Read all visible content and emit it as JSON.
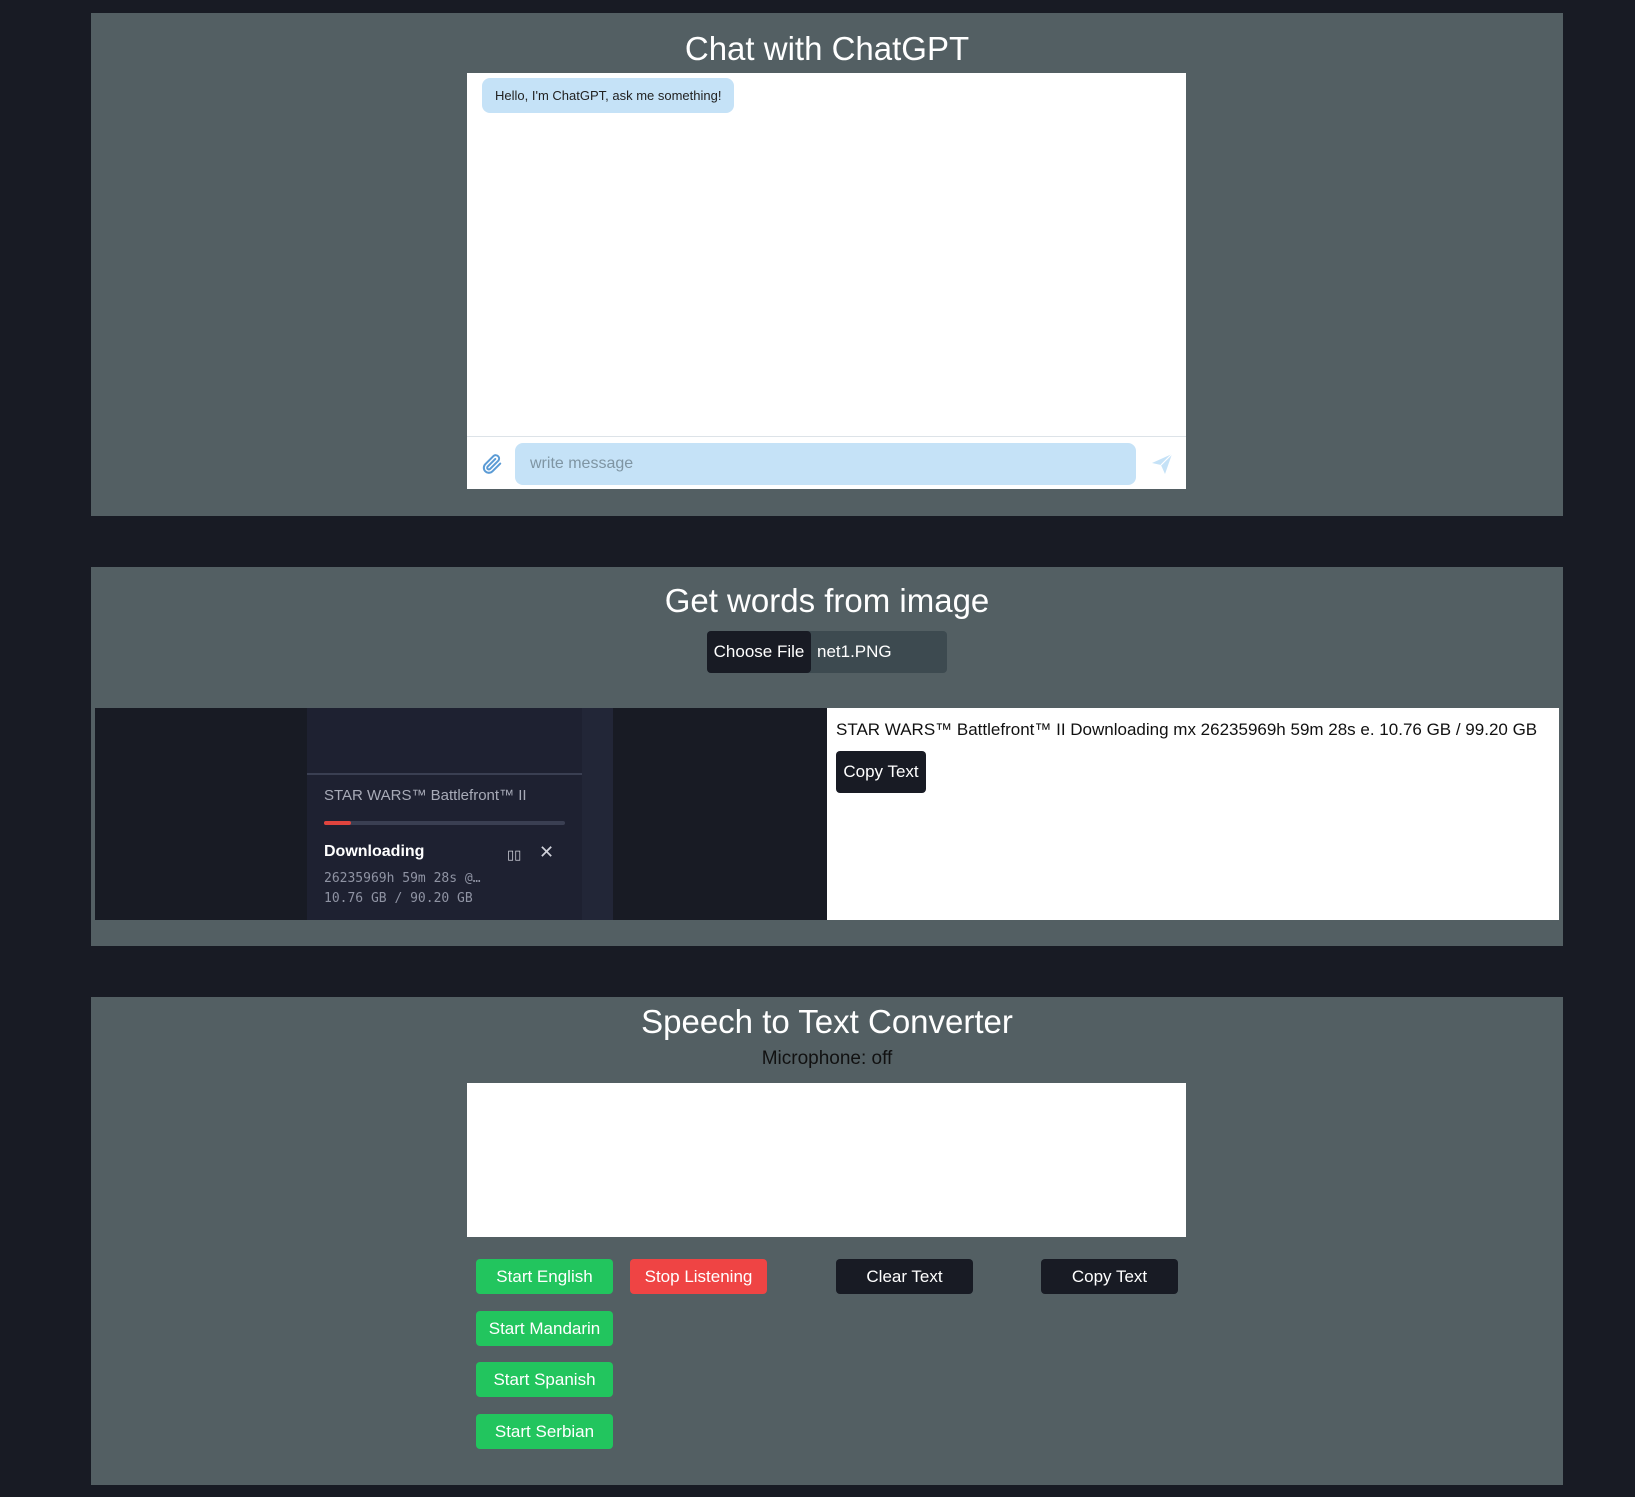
{
  "chat": {
    "title": "Chat with ChatGPT",
    "greeting": "Hello, I'm ChatGPT, ask me something!",
    "input_placeholder": "write message",
    "input_value": "",
    "attach_icon": "paperclip-icon",
    "send_icon": "send-icon"
  },
  "image_ocr": {
    "title": "Get words from image",
    "choose_file_label": "Choose File",
    "file_name": "net1.PNG",
    "preview": {
      "game_title": "STAR WARS™ Battlefront™ II",
      "progress": 0.11,
      "progress_color": "#e0443e",
      "status": "Downloading",
      "pause_icon": "pause-icon",
      "close_icon": "close-icon",
      "time_remaining": "26235969h 59m 28s @…",
      "size": "10.76 GB / 90.20 GB"
    },
    "extracted_text": "STAR WARS™ Battlefront™ II Downloading mx 26235969h 59m 28s e. 10.76 GB / 99.20 GB",
    "copy_label": "Copy Text"
  },
  "speech": {
    "title": "Speech to Text Converter",
    "mic_status": "Microphone: off",
    "transcript": "",
    "buttons": {
      "start_english": "Start English",
      "stop_listening": "Stop Listening",
      "clear_text": "Clear Text",
      "copy_text": "Copy Text",
      "start_mandarin": "Start Mandarin",
      "start_spanish": "Start Spanish",
      "start_serbian": "Start Serbian"
    }
  },
  "colors": {
    "page_bg": "#181b24",
    "panel_bg": "#535f63",
    "bubble_bg": "#c5e2f7",
    "green": "#22c55e",
    "red": "#ef4444"
  }
}
